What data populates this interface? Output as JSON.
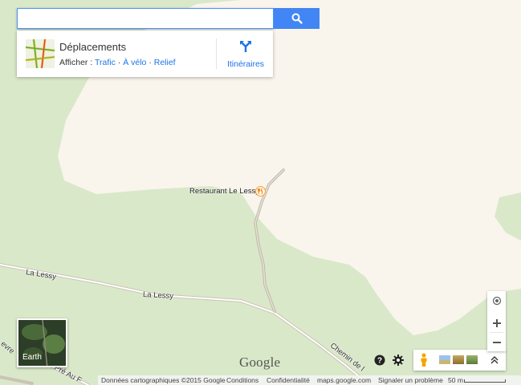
{
  "search": {
    "value": "",
    "placeholder": ""
  },
  "transit": {
    "title": "Déplacements",
    "show_label": "Afficher :",
    "links": [
      "Trafic",
      "À vélo",
      "Relief"
    ],
    "separator": "·",
    "directions_label": "Itinéraires"
  },
  "map": {
    "place": {
      "name": "Restaurant Le Lessy",
      "icon": "restaurant-icon"
    },
    "roads": [
      "La Lessy",
      "La Lessy",
      "Chemin de l",
      "Pré Au F",
      "evre"
    ],
    "colors": {
      "land": "#f9f5ec",
      "forest": "#d9e8c9",
      "road": "#cfc6b6",
      "accent": "#4285f4"
    }
  },
  "earth": {
    "label": "Earth"
  },
  "logo": "Google",
  "footer": {
    "map_data": "Données cartographiques ©2015 Google",
    "links": [
      "Conditions",
      "Confidentialité",
      "maps.google.com",
      "Signaler un problème"
    ],
    "scale": "50 m"
  }
}
